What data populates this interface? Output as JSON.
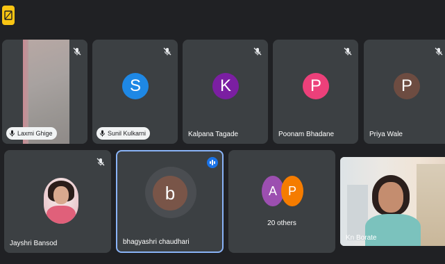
{
  "participants": {
    "row1": [
      {
        "name": "Laxmi Ghige",
        "has_video": true,
        "mic_off": true
      },
      {
        "name": "Sunil Kulkarni",
        "initial": "S",
        "color": "#1e88e5",
        "mic_off": true
      },
      {
        "name": "Kalpana Tagade",
        "initial": "K",
        "color": "#7b1fa2",
        "mic_off": true
      },
      {
        "name": "Poonam Bhadane",
        "initial": "P",
        "color": "#ec407a",
        "mic_off": true
      },
      {
        "name": "Priya Wale",
        "initial": "P",
        "color": "#6d4c41",
        "mic_off": true
      }
    ],
    "row2": [
      {
        "name": "Jayshri Bansod",
        "has_video": true,
        "mic_off": true
      },
      {
        "name": "bhagyashri chaudhari",
        "initial": "b",
        "color": "#795548",
        "speaking": true
      },
      {
        "others_initials": [
          "A",
          "P"
        ],
        "others_colors": [
          "#9c4fb0",
          "#f57c00"
        ],
        "others_label": "20 others"
      },
      {
        "name": "Kn Borate",
        "has_video": true
      }
    ]
  },
  "colors": {
    "background": "#202124",
    "tile": "#3c4043",
    "active_border": "#8ab4f8",
    "app_icon": "#f9c513"
  }
}
